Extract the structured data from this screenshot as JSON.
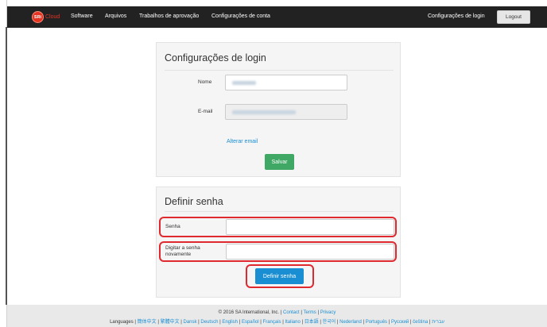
{
  "navbar": {
    "logo_text": "SRi",
    "brand_text": "Cloud",
    "links": [
      "Software",
      "Arquivos",
      "Trabalhos de aprovação",
      "Configurações de conta"
    ],
    "right_link": "Configurações de login",
    "logout_label": "Logout"
  },
  "login_panel": {
    "title": "Configurações de login",
    "name_label": "Nome",
    "email_label": "E-mail",
    "change_email_link": "Alterar email",
    "save_label": "Salvar"
  },
  "password_panel": {
    "title": "Definir senha",
    "password_label": "Senha",
    "confirm_label": "Digitar a senha novamente",
    "set_password_label": "Definir senha"
  },
  "footer": {
    "copyright": "© 2016 SA International, Inc. |",
    "links_top": [
      "Contact",
      "Terms",
      "Privacy"
    ],
    "languages_label": "Languages |",
    "languages": [
      "簡体中文",
      "繁體中文",
      "Dansk",
      "Deutsch",
      "English",
      "Español",
      "Français",
      "Italiano",
      "日本語",
      "한국어",
      "Nederland",
      "Português",
      "Русский",
      "čeština",
      "עברית"
    ]
  },
  "colors": {
    "navbar_bg": "#222222",
    "brand_red": "#e53422",
    "link_blue": "#1a8ed3",
    "save_green": "#3ea864",
    "highlight_red": "#e0292e"
  }
}
